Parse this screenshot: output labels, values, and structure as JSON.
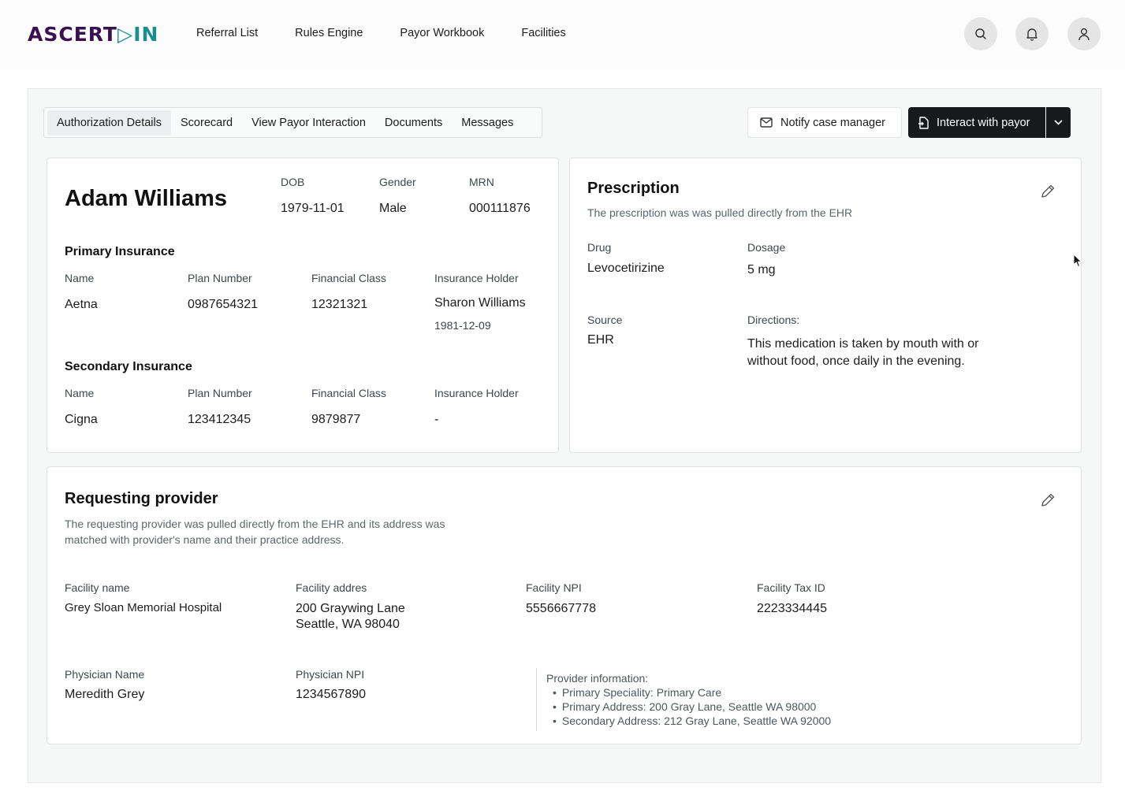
{
  "brand": {
    "logo_left": "ASCERT",
    "logo_accent": "▷IN",
    "accent_color": "#1a8d8d",
    "primary_color": "#3a1150"
  },
  "nav": {
    "items": [
      "Referral List",
      "Rules Engine",
      "Payor Workbook",
      "Facilities"
    ]
  },
  "header_icons": [
    "search-icon",
    "bell-icon",
    "user-icon"
  ],
  "tabs": [
    "Authorization Details",
    "Scorecard",
    "View Payor Interaction",
    "Documents",
    "Messages"
  ],
  "active_tab": "Authorization Details",
  "actions": {
    "notify": "Notify case manager",
    "interact": "Interact with payor"
  },
  "patient": {
    "name": "Adam Williams",
    "dob_label": "DOB",
    "dob": "1979-11-01",
    "gender_label": "Gender",
    "gender": "Male",
    "mrn_label": "MRN",
    "mrn": "000111876"
  },
  "primary_insurance": {
    "title": "Primary Insurance",
    "labels": {
      "name": "Name",
      "plan": "Plan Number",
      "fin": "Financial Class",
      "holder": "Insurance Holder"
    },
    "name": "Aetna",
    "plan": "0987654321",
    "fin": "12321321",
    "holder": "Sharon Williams",
    "holder_dob": "1981-12-09"
  },
  "secondary_insurance": {
    "title": "Secondary Insurance",
    "labels": {
      "name": "Name",
      "plan": "Plan Number",
      "fin": "Financial Class",
      "holder": "Insurance Holder"
    },
    "name": "Cigna",
    "plan": "123412345",
    "fin": "9879877",
    "holder": "-"
  },
  "prescription": {
    "title": "Prescription",
    "subtitle": "The prescription was was pulled directly from the EHR",
    "drug_label": "Drug",
    "drug": "Levocetirizine",
    "dosage_label": "Dosage",
    "dosage": "5 mg",
    "source_label": "Source",
    "source": "EHR",
    "directions_label": "Directions:",
    "directions_line1": "This medication is taken by mouth with or",
    "directions_line2": "without food, once daily in the evening."
  },
  "provider": {
    "title": "Requesting provider",
    "subtitle_line1": "The requesting provider was pulled directly from the EHR and its address was",
    "subtitle_line2": "matched with provider's name and their practice address.",
    "facility_name_label": "Facility name",
    "facility_name": "Grey Sloan Memorial Hospital",
    "facility_address_label": "Facility addres",
    "facility_address_line1": "200 Graywing Lane",
    "facility_address_line2": "Seattle, WA 98040",
    "facility_npi_label": "Facility NPI",
    "facility_npi": "5556667778",
    "facility_tax_label": "Facility Tax ID",
    "facility_tax": "2223334445",
    "physician_name_label": "Physician Name",
    "physician_name": "Meredith Grey",
    "physician_npi_label": "Physician NPI",
    "physician_npi": "1234567890",
    "info_title": "Provider information:",
    "info_items": [
      "Primary Speciality: Primary Care",
      "Primary Address: 200 Gray Lane, Seattle WA 98000",
      "Secondary Address: 212 Gray Lane, Seattle WA 92000"
    ]
  }
}
